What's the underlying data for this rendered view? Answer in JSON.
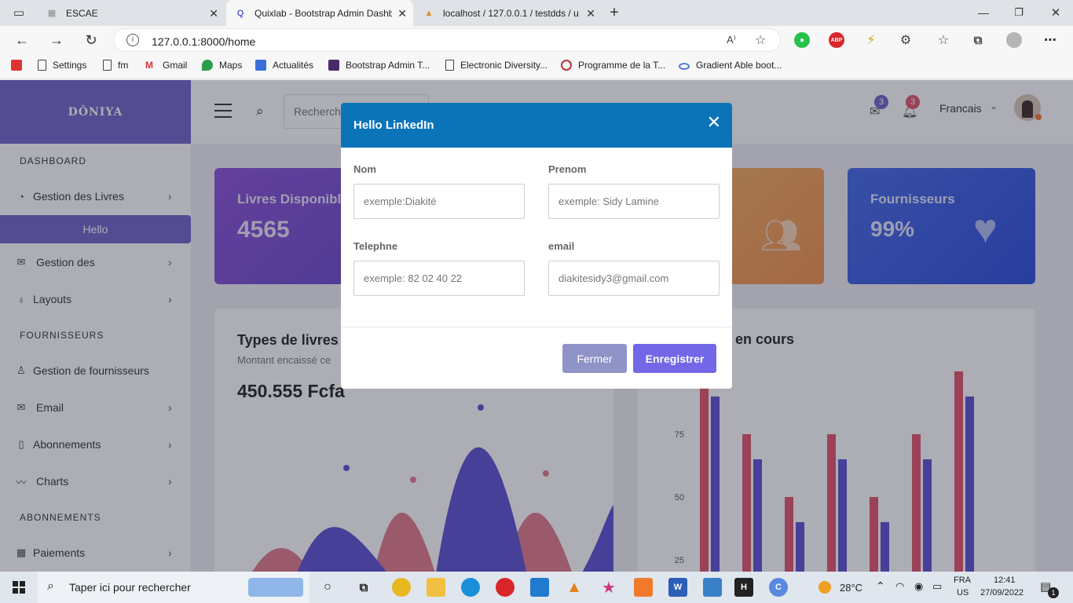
{
  "browser": {
    "tabs": [
      {
        "title": "ESCAE",
        "icon": "escae-icon"
      },
      {
        "title": "Quixlab - Bootstrap Admin Dashboard",
        "icon": "quixlab-icon",
        "active": true
      },
      {
        "title": "localhost / 127.0.0.1 / testdds / u",
        "icon": "phpmyadmin-icon"
      }
    ],
    "new_tab": "+",
    "url": "127.0.0.1:8000/home",
    "bookmarks": [
      "Settings",
      "fm",
      "Gmail",
      "Maps",
      "Actualités",
      "Bootstrap Admin T...",
      "Electronic Diversity...",
      "Programme de la T...",
      "Gradient Able boot..."
    ]
  },
  "sidebar": {
    "brand": "DÔNIYA",
    "sections": [
      "DASHBOARD",
      "FOURNISSEURS",
      "ABONNEMENTS"
    ],
    "items": [
      {
        "label": "Gestion des Livres",
        "icon": "dashboard-icon",
        "chevron": true
      },
      {
        "label": "Hello",
        "active": true
      },
      {
        "label": "Gestion des",
        "icon": "mail-icon",
        "chevron": true
      },
      {
        "label": "Layouts",
        "icon": "bulb-icon",
        "chevron": true
      },
      {
        "label": "Gestion de fournisseurs",
        "icon": "user-icon",
        "chevron": false
      },
      {
        "label": "Email",
        "icon": "envelope-icon",
        "chevron": true
      },
      {
        "label": "Abonnements",
        "icon": "phone-icon",
        "chevron": true
      },
      {
        "label": "Charts",
        "icon": "chart-icon",
        "chevron": true
      },
      {
        "label": "Paiements",
        "icon": "grid-icon",
        "chevron": true
      }
    ]
  },
  "topbar": {
    "search_placeholder": "Recherche",
    "mail_badge": "3",
    "bell_badge": "3",
    "language": "Francais"
  },
  "cards": [
    {
      "title": "Livres Disponible",
      "value": "4565",
      "color": "#7b4fd0"
    },
    {
      "title": "",
      "value": "",
      "color": "#f0a050"
    },
    {
      "title": "Fournisseurs",
      "value": "99%",
      "color": "#3b5fe0"
    }
  ],
  "panels": {
    "left_title": "Types de livres",
    "left_subtitle": "Montant encaissé ce",
    "left_amount": "450.555 Fcfa",
    "right_title": "s en cours"
  },
  "chart_data": {
    "type": "bar",
    "ytick_labels": [
      "75",
      "50",
      "25"
    ],
    "series": [
      {
        "values": [
          95,
          75,
          50,
          75,
          50,
          75,
          100
        ],
        "color": "#e0536a"
      },
      {
        "values": [
          90,
          65,
          40,
          65,
          40,
          65,
          90
        ],
        "color": "#5a4fd0"
      }
    ],
    "ylim": [
      0,
      100
    ]
  },
  "modal": {
    "title": "Hello LinkedIn",
    "fields": {
      "nom_label": "Nom",
      "nom_placeholder": "exemple:Diakité",
      "prenom_label": "Prenom",
      "prenom_placeholder": "exemple: Sidy Lamine",
      "telephone_label": "Telephne",
      "telephone_placeholder": "exemple: 82 02 40 22",
      "email_label": "email",
      "email_placeholder": "diakitesidy3@gmail.com"
    },
    "close_label": "Fermer",
    "save_label": "Enregistrer"
  },
  "taskbar": {
    "search_placeholder": "Taper ici pour rechercher",
    "temperature": "28°C",
    "lang_top": "FRA",
    "lang_bottom": "US",
    "time": "12:41",
    "date": "27/09/2022",
    "notif_count": "1"
  }
}
